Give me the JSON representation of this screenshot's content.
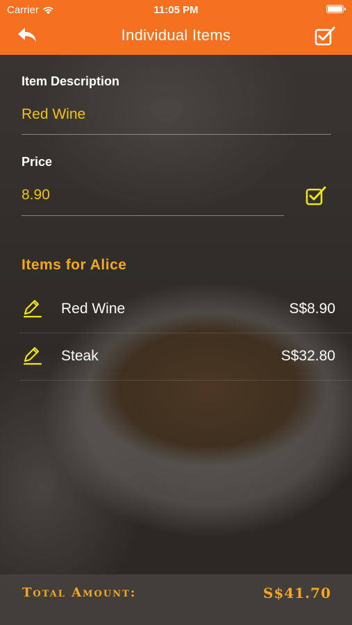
{
  "status": {
    "carrier": "Carrier",
    "time": "11:05 PM"
  },
  "nav": {
    "title": "Individual Items",
    "back_icon": "back-arrow-icon",
    "confirm_icon": "checkbox-confirm-icon"
  },
  "form": {
    "description_label": "Item Description",
    "description_value": "Red Wine",
    "price_label": "Price",
    "price_value": "8.90",
    "price_confirm_icon": "checkbox-confirm-icon"
  },
  "items_section": {
    "title": "Items for Alice",
    "items": [
      {
        "name": "Red Wine",
        "amount": "S$8.90",
        "icon": "pencil-edit-icon"
      },
      {
        "name": "Steak",
        "amount": "S$32.80",
        "icon": "pencil-edit-icon"
      }
    ]
  },
  "footer": {
    "total_label": "Total Amount:",
    "total_value": "S$41.70"
  },
  "colors": {
    "nav_bar": "#f5701f",
    "accent_yellow": "#f2c21b",
    "accent_orange": "#f5a623"
  }
}
